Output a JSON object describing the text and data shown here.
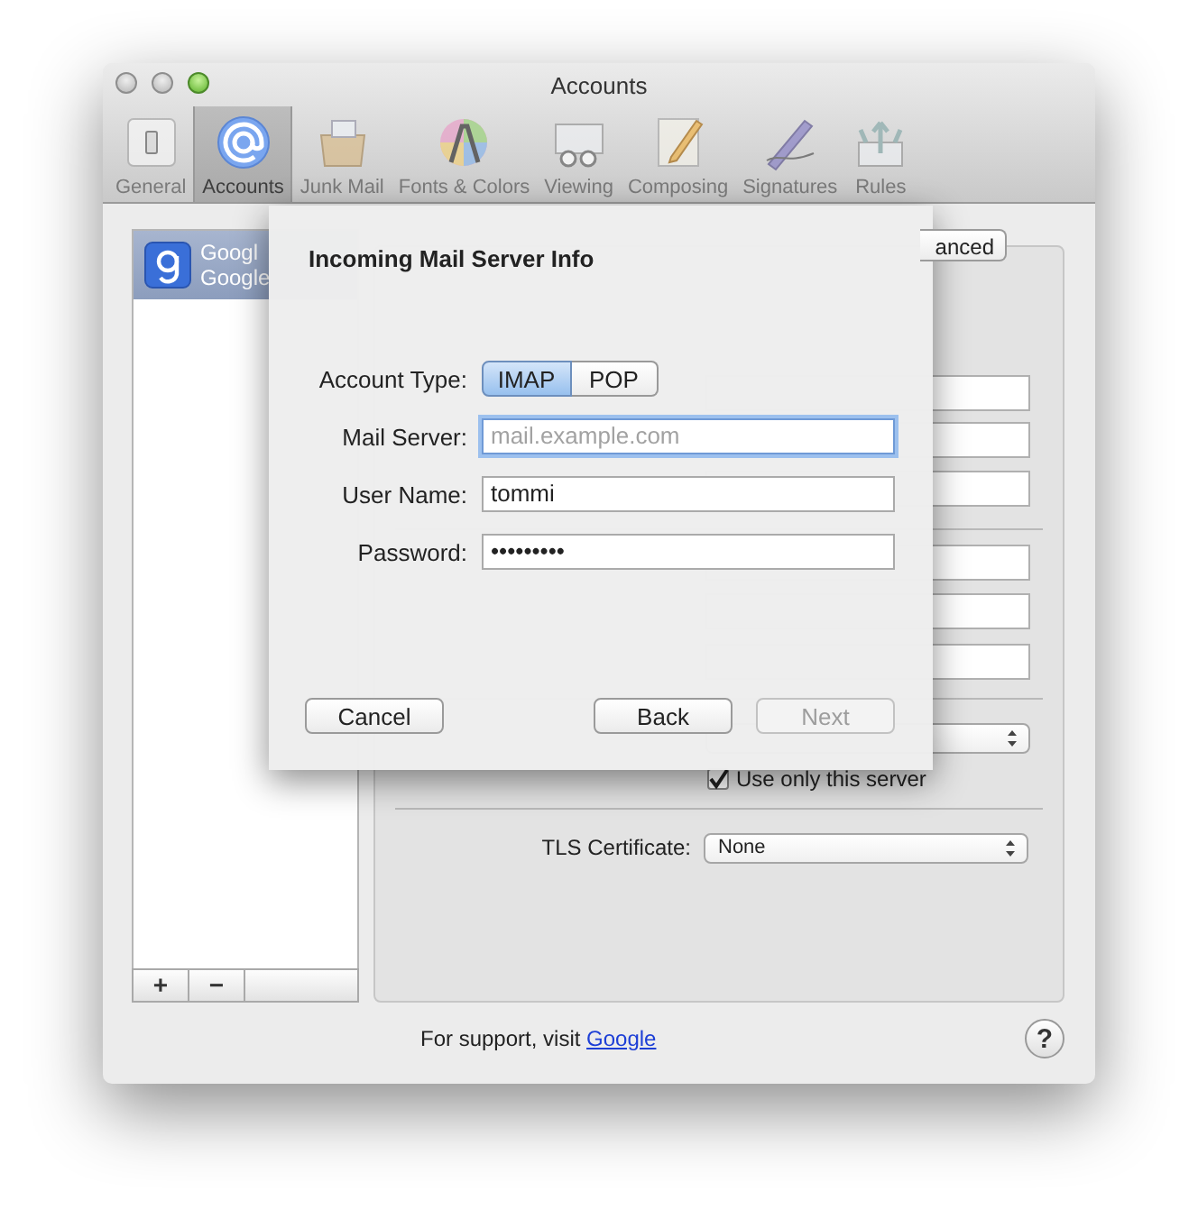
{
  "window": {
    "title": "Accounts"
  },
  "toolbar": [
    {
      "label": "General",
      "selected": false
    },
    {
      "label": "Accounts",
      "selected": true
    },
    {
      "label": "Junk Mail",
      "selected": false
    },
    {
      "label": "Fonts & Colors",
      "selected": false
    },
    {
      "label": "Viewing",
      "selected": false
    },
    {
      "label": "Composing",
      "selected": false
    },
    {
      "label": "Signatures",
      "selected": false
    },
    {
      "label": "Rules",
      "selected": false
    }
  ],
  "accounts": [
    {
      "name": "Googl",
      "subtitle": "Google",
      "selected": true
    }
  ],
  "list_buttons": [
    "+",
    "−"
  ],
  "tabs": [
    {
      "label": "anced",
      "selected": false
    }
  ],
  "settings": {
    "use_only_this_server": {
      "label": "Use only this server",
      "checked": true
    },
    "tls": {
      "label": "TLS Certificate:",
      "value": "None"
    }
  },
  "support": {
    "text": "For support, visit",
    "link": "Google"
  },
  "help": "?",
  "sheet": {
    "title": "Incoming Mail Server Info",
    "account_type": {
      "label": "Account Type:",
      "options": [
        {
          "label": "IMAP",
          "selected": true
        },
        {
          "label": "POP",
          "selected": false
        }
      ]
    },
    "fields": [
      {
        "label": "Mail Server:",
        "placeholder": "mail.example.com",
        "focused": true
      },
      {
        "label": "User Name:",
        "value": "tommi",
        "focused": false
      },
      {
        "label": "Password:",
        "value": "•••••••••",
        "focused": false
      }
    ],
    "buttons": [
      {
        "label": "Cancel",
        "disabled": false
      },
      {
        "label": "Back",
        "disabled": false
      },
      {
        "label": "Next",
        "disabled": true
      }
    ]
  }
}
